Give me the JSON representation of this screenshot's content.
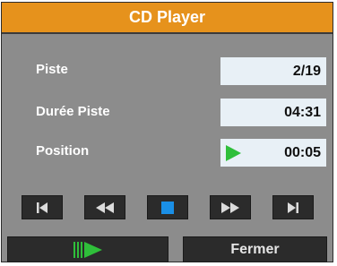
{
  "window": {
    "title": "CD Player"
  },
  "fields": {
    "track": {
      "label": "Piste",
      "value": "2/19"
    },
    "duration": {
      "label": "Durée Piste",
      "value": "04:31"
    },
    "position": {
      "label": "Position",
      "value": "00:05"
    }
  },
  "transport": {
    "buttons": [
      {
        "name": "previous-track",
        "icon": "skip-back-icon"
      },
      {
        "name": "rewind",
        "icon": "rewind-icon"
      },
      {
        "name": "stop",
        "icon": "stop-icon"
      },
      {
        "name": "fast-forward",
        "icon": "fast-forward-icon"
      },
      {
        "name": "next-track",
        "icon": "skip-forward-icon"
      }
    ]
  },
  "actions": {
    "close_label": "Fermer"
  },
  "colors": {
    "title_bar": "#e6921c",
    "panel": "#8c8c8c",
    "accent_green": "#2fbf3a",
    "stop_blue": "#1a8fe6"
  }
}
